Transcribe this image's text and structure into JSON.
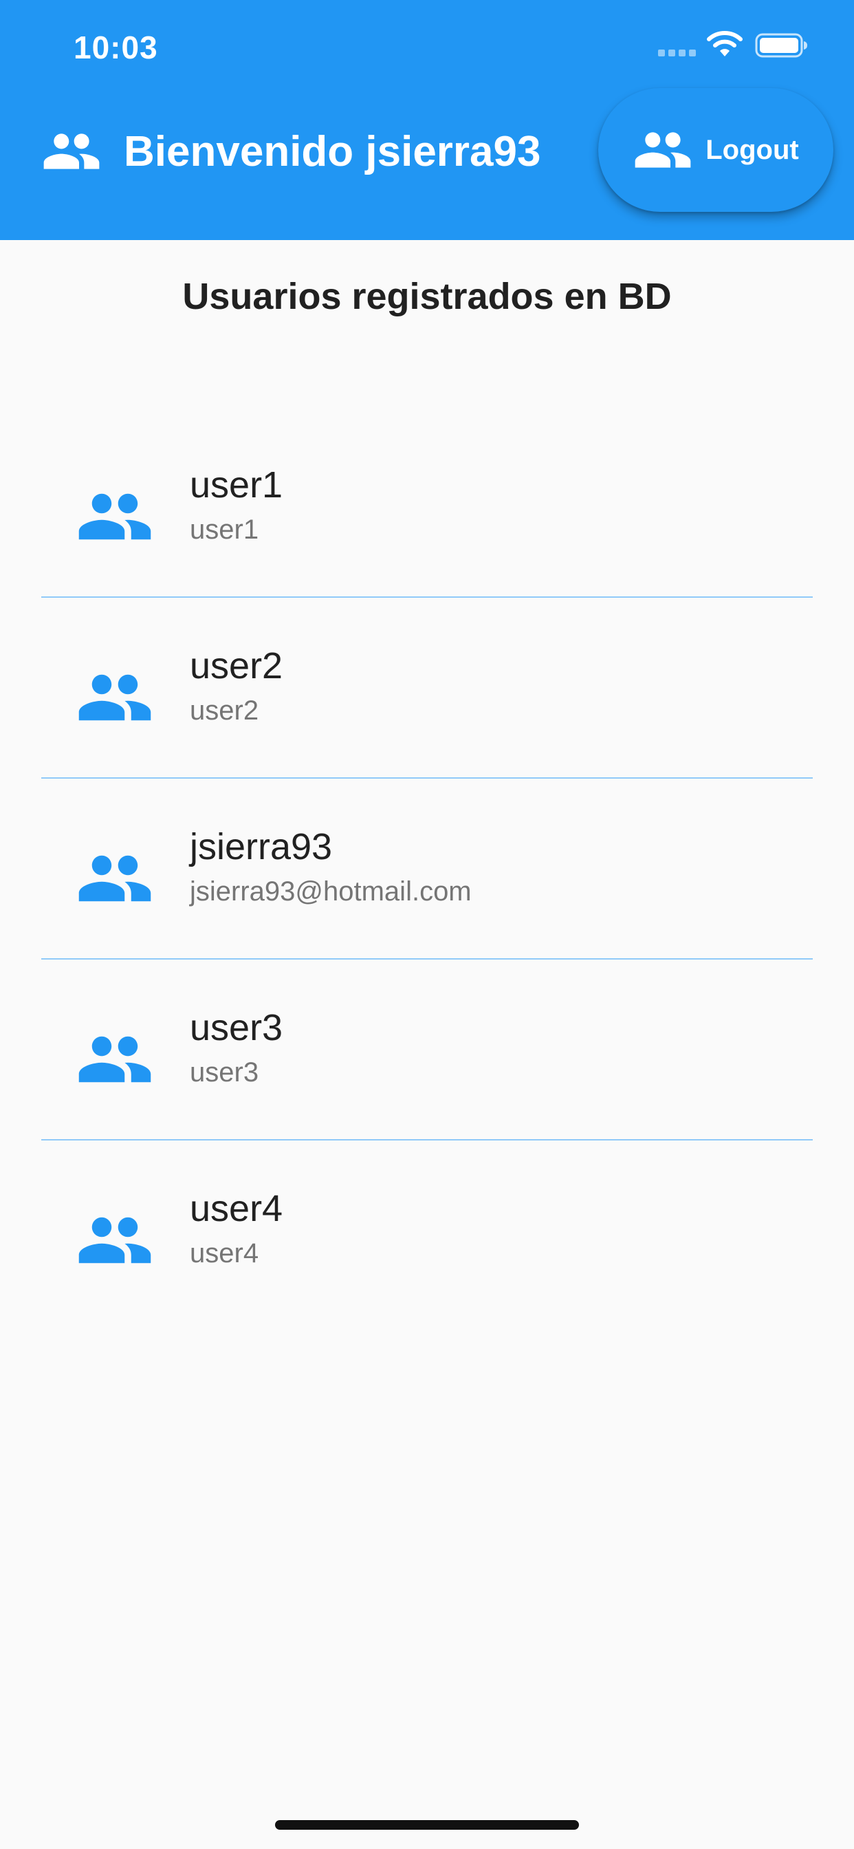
{
  "status_bar": {
    "time": "10:03"
  },
  "app_bar": {
    "title": "Bienvenido jsierra93",
    "title_icon": "group-icon",
    "logout_label": "Logout",
    "logout_icon": "group-icon",
    "background_color": "#2196f3"
  },
  "main": {
    "page_title": "Usuarios registrados en BD",
    "users": [
      {
        "name": "user1",
        "subtitle": "user1",
        "icon": "group-icon"
      },
      {
        "name": "user2",
        "subtitle": "user2",
        "icon": "group-icon"
      },
      {
        "name": "jsierra93",
        "subtitle": "jsierra93@hotmail.com",
        "icon": "group-icon"
      },
      {
        "name": "user3",
        "subtitle": "user3",
        "icon": "group-icon"
      },
      {
        "name": "user4",
        "subtitle": "user4",
        "icon": "group-icon"
      }
    ],
    "icon_color": "#2196f3",
    "divider_color": "#90caf9"
  }
}
